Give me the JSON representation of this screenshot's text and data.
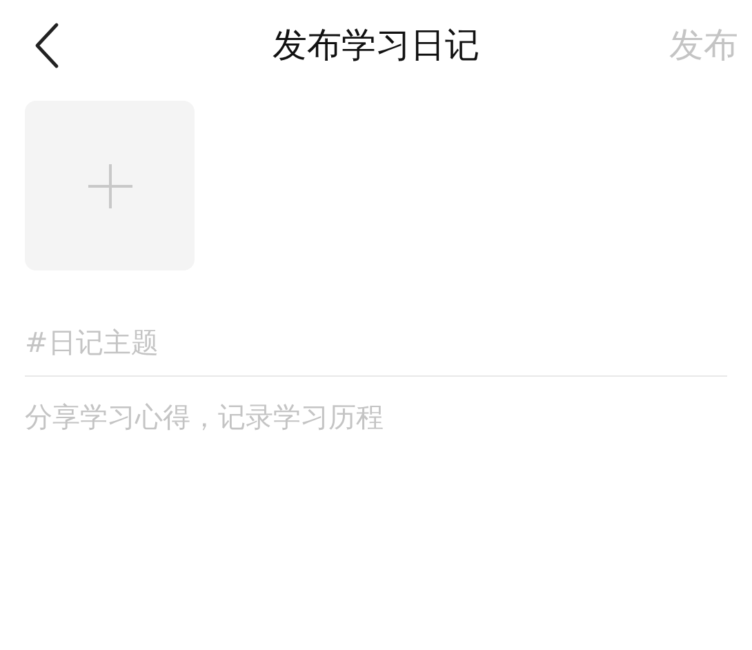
{
  "header": {
    "title": "发布学习日记",
    "publish_button": {
      "label": "发布",
      "disabled": true
    }
  },
  "topic_field": {
    "placeholder": "#日记主题"
  },
  "content_field": {
    "placeholder": "分享学习心得，记录学习历程"
  }
}
